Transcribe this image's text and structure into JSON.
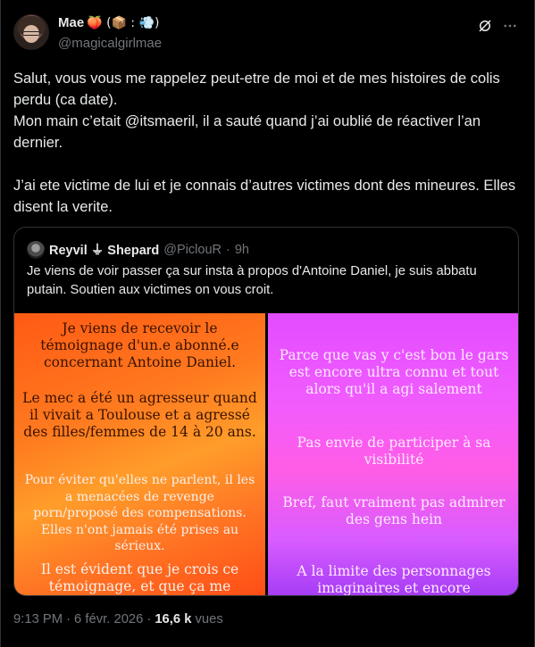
{
  "author": {
    "display_name": "Mae",
    "name_emojis": "🍑 (📦 : 💨)",
    "handle": "@magicalgirlmae"
  },
  "icons": {
    "grok": "grok-icon",
    "more": "more-icon"
  },
  "tweet": {
    "paragraphs": [
      "Salut, vous vous me rappelez peut-etre de moi et de mes histoires de colis perdu (ca date).",
      "Mon main c’etait @itsmaeril, il a sauté quand j’ai oublié de réactiver l’an dernier.",
      "J’ai ete victime de lui et je connais d’autres victimes dont des mineures. Elles disent la verite."
    ]
  },
  "quote": {
    "name": "Reyvil ⏚ Shepard",
    "handle": "@PiclouR",
    "separator": "·",
    "time": "9h",
    "text": "Je viens de voir passer ça sur insta à propos d'Antoine Daniel, je suis abbatu putain. Soutien aux victimes on vous croit."
  },
  "media": {
    "left": [
      "Je viens de recevoir le témoignage d'un.e abonné.e concernant Antoine Daniel.",
      "Le mec a été un agresseur quand il vivait a Toulouse et a agressé des filles/femmes de 14 à 20 ans.",
      "Pour éviter qu'elles ne parlent, il les a menacées de revenge porn/proposé des compensations. Elles n'ont jamais été prises au sérieux.",
      "Il est évident que je crois ce témoignage, et que ça me"
    ],
    "right": [
      "Parce que vas y c'est bon le gars est encore ultra connu et tout alors qu'il a agi salement",
      "Pas envie de participer à sa visibilité",
      "Bref, faut vraiment pas admirer des gens hein",
      "A la limite des personnages imaginaires et encore"
    ]
  },
  "footer": {
    "time": "9:13 PM",
    "separator": "·",
    "date": "6 févr. 2026",
    "separator2": "·",
    "views_count": "16,6 k",
    "views_label": "vues"
  },
  "colors": {
    "background": "#000000",
    "text": "#e7e9ea",
    "secondary": "#71767b",
    "border": "#2f3336"
  }
}
